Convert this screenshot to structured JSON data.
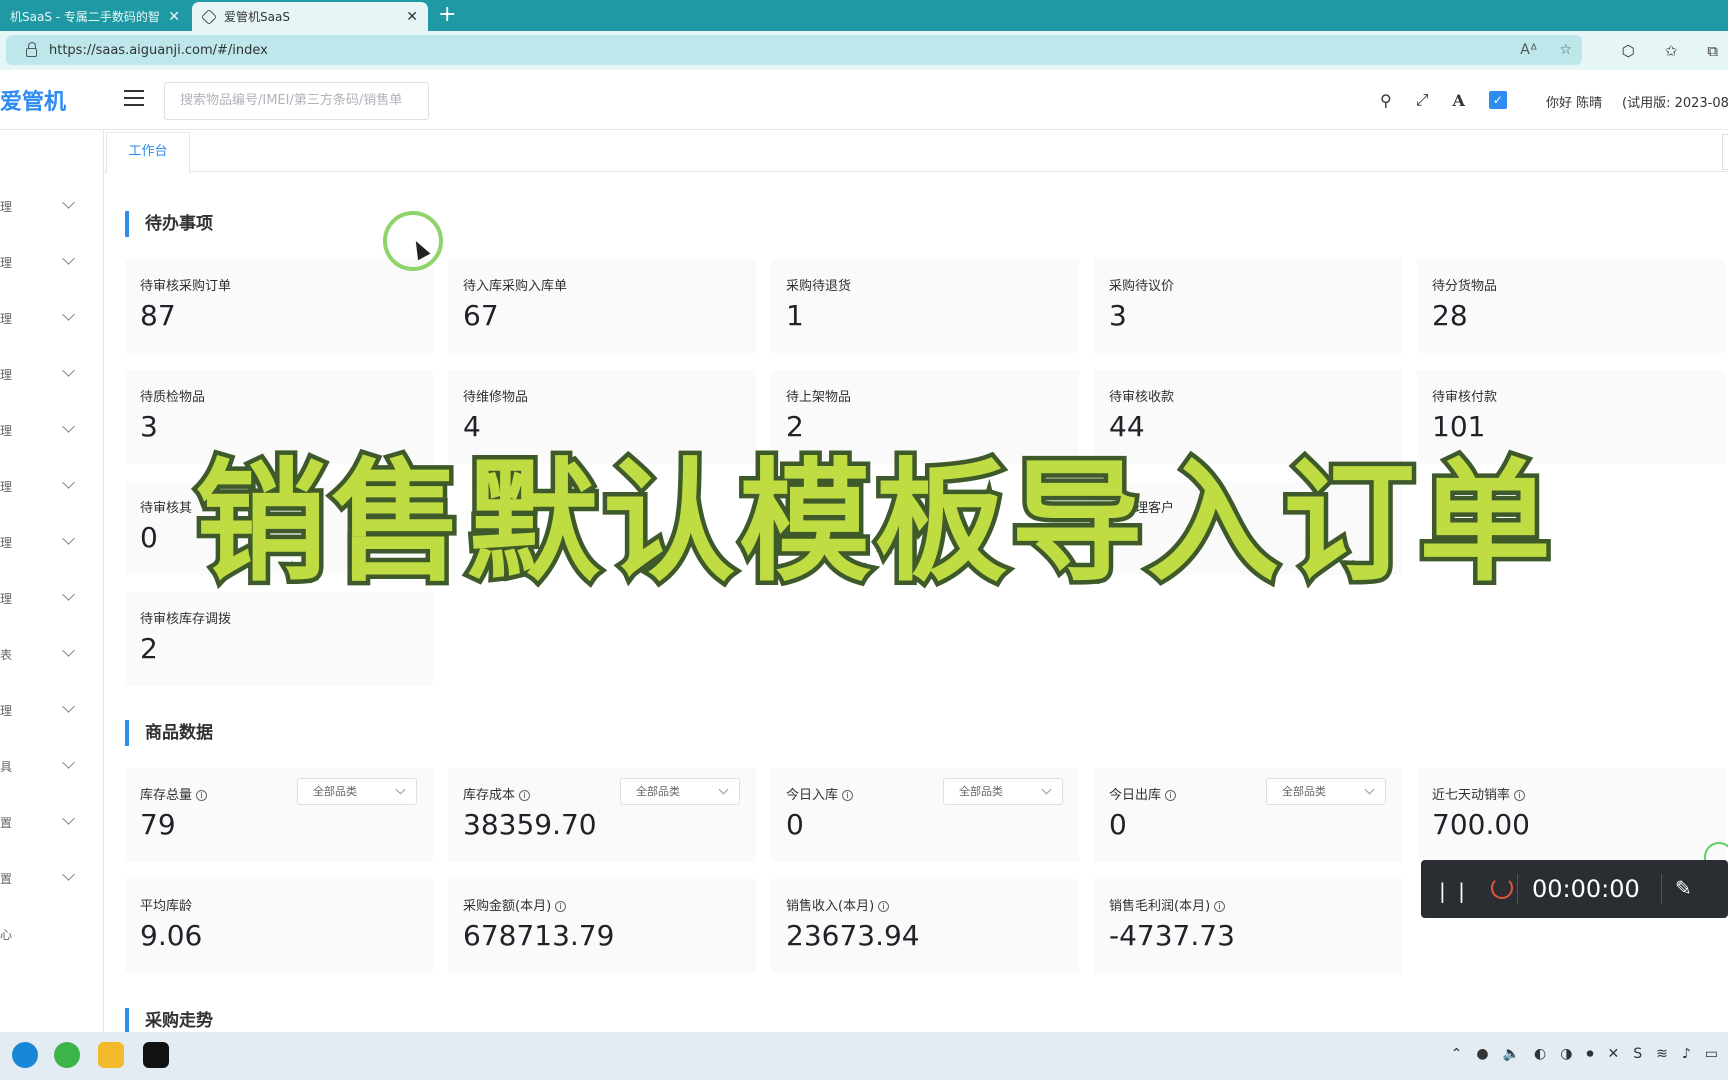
{
  "browser": {
    "tabs": [
      {
        "title": "机SaaS - 专属二手数码的智",
        "active": false
      },
      {
        "title": "爱管机SaaS",
        "active": true
      }
    ],
    "new_tab": "+",
    "url": "https://saas.aiguanji.com/#/index"
  },
  "header": {
    "logo": "爱管机",
    "search_placeholder": "搜索物品编号/IMEI/第三方条码/销售单",
    "greeting": "你好 陈晴",
    "trial": "(试用版: 2023-08"
  },
  "sidebar": {
    "items": [
      "理",
      "理",
      "理",
      "理",
      "理",
      "理",
      "理",
      "理",
      "表",
      "理",
      "具",
      "置",
      "置",
      "心"
    ]
  },
  "page_tabs": [
    {
      "label": "工作台"
    }
  ],
  "todo": {
    "title": "待办事项",
    "cards": [
      {
        "label": "待审核采购订单",
        "value": "87"
      },
      {
        "label": "待入库采购入库单",
        "value": "67"
      },
      {
        "label": "采购待退货",
        "value": "1"
      },
      {
        "label": "采购待议价",
        "value": "3"
      },
      {
        "label": "待分货物品",
        "value": "28"
      },
      {
        "label": "待质检物品",
        "value": "3"
      },
      {
        "label": "待维修物品",
        "value": "4"
      },
      {
        "label": "待上架物品",
        "value": "2"
      },
      {
        "label": "待审核收款",
        "value": "44"
      },
      {
        "label": "待审核付款",
        "value": "101"
      },
      {
        "label": "待审核其",
        "value": "0"
      },
      {
        "label": "待处理客户",
        "value": ""
      },
      {
        "label": "待审核库存调拨",
        "value": "2"
      }
    ]
  },
  "goods": {
    "title": "商品数据",
    "select_label": "全部品类",
    "cards": [
      {
        "label": "库存总量",
        "value": "79"
      },
      {
        "label": "库存成本",
        "value": "38359.70"
      },
      {
        "label": "今日入库",
        "value": "0"
      },
      {
        "label": "今日出库",
        "value": "0"
      },
      {
        "label": "近七天动销率",
        "value": "700.00"
      },
      {
        "label": "平均库龄",
        "value": "9.06"
      },
      {
        "label": "采购金额(本月)",
        "value": "678713.79"
      },
      {
        "label": "销售收入(本月)",
        "value": "23673.94"
      },
      {
        "label": "销售毛利润(本月)",
        "value": "-4737.73"
      }
    ]
  },
  "purchase_trend": {
    "title": "采购走势"
  },
  "overlay_caption": "销售默认模板导入订单",
  "recorder": {
    "time": "00:00:00"
  }
}
